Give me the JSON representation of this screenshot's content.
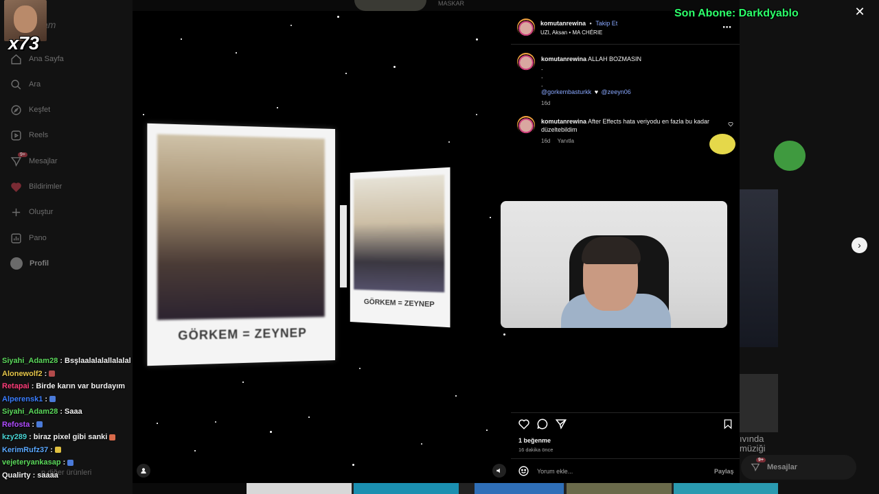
{
  "sidebar": {
    "brand_fragment": "am",
    "items": [
      {
        "label": "Ana Sayfa",
        "icon": "home-icon"
      },
      {
        "label": "Ara",
        "icon": "search-icon"
      },
      {
        "label": "Keşfet",
        "icon": "compass-icon"
      },
      {
        "label": "Reels",
        "icon": "reels-icon"
      },
      {
        "label": "Mesajlar",
        "icon": "messenger-icon",
        "badge": "9+"
      },
      {
        "label": "Bildirimler",
        "icon": "heart-icon"
      },
      {
        "label": "Oluştur",
        "icon": "plus-icon"
      },
      {
        "label": "Pano",
        "icon": "chart-icon"
      },
      {
        "label": "Profil",
        "icon": "avatar"
      }
    ],
    "footer_fragment": "n diğer ürünleri"
  },
  "overlay": {
    "combo": "x73",
    "sub_alert": "Son Abone: Darkdyablo",
    "top_name_fragment": "MASKAR"
  },
  "chat": [
    {
      "user": "Siyahi_Adam28",
      "msg": "Bsşlaalalalallalalal",
      "color": "#5bd85b"
    },
    {
      "user": "Alonewolf2",
      "msg": "",
      "color": "#e6c64a",
      "emote": "#b24a4a"
    },
    {
      "user": "Retapai",
      "msg": "Birde karın var burdayım",
      "color": "#ff3d7a"
    },
    {
      "user": "Alperensk1",
      "msg": "",
      "color": "#3a7dff",
      "emote": "#4a7ad8"
    },
    {
      "user": "Siyahi_Adam28",
      "msg": "Saaa",
      "color": "#5bd85b"
    },
    {
      "user": "Refosta",
      "msg": "",
      "color": "#b04cff",
      "emote": "#4a7ad8"
    },
    {
      "user": "kzy289",
      "msg": "biraz pixel gibi sanki",
      "color": "#49d3d3",
      "emote": "#d86a4a"
    },
    {
      "user": "KerimRufz37",
      "msg": "",
      "color": "#5aa8ff",
      "emote": "#e0c040"
    },
    {
      "user": "vejeteryankasap",
      "msg": "",
      "color": "#5bd85b",
      "emote": "#4a7ad8"
    },
    {
      "user": "Qualirty",
      "msg": "saaaa",
      "color": "#f2f2f2"
    }
  ],
  "post": {
    "caption_big": "GÖRKEM = ZEYNEP",
    "caption_small": "GÖRKEM = ZEYNEP",
    "author": "komutanrewina",
    "dot": "•",
    "follow": "Takip Et",
    "audio": "UZI, Aksan • MA CHÉRIE",
    "caption_user": "komutanrewina",
    "caption_text": "ALLAH BOZMASIN",
    "caption_dot1": ".",
    "caption_dot2": ".",
    "caption_dot3": ".",
    "mention1": "@gorkembasturkk",
    "heart": "♥",
    "mention2": "@zeeyn06",
    "caption_time": "16d",
    "comment_user": "komutanrewina",
    "comment_text_1": "After Effects hata veriyodu en fazla bu kadar",
    "comment_text_2": "düzeltebildim",
    "comment_time": "16d",
    "reply": "Yanıtla",
    "likes": "1 beğenme",
    "posted": "16 dakika önce",
    "comment_placeholder": "Yorum ekle...",
    "share": "Paylaş"
  },
  "right_bg": {
    "text1": "ıvında",
    "text2": "müziği",
    "messages_label": "Mesajlar",
    "messages_badge": "9+"
  }
}
